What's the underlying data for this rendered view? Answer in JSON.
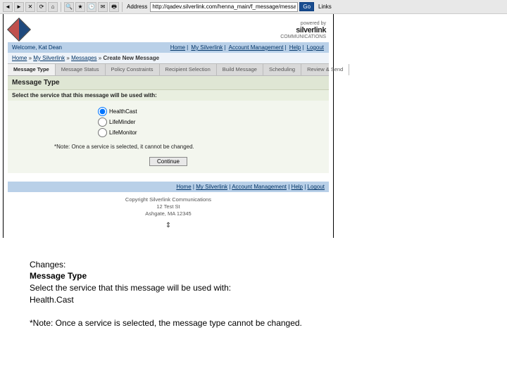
{
  "toolbar": {
    "address_label": "Address",
    "address_value": "http://qadev.silverlink.com/henna_main/f_message/message_list_task?.aspx",
    "go_label": "Go",
    "links_label": "Links"
  },
  "brand": {
    "powered_by": "powered by",
    "company": "silverlink",
    "tagline": "COMMUNICATIONS"
  },
  "welcomebar": {
    "left": "Welcome, Kat Dean",
    "links": [
      "Home",
      "My Silverlink",
      "Account Management",
      "Help",
      "Logout"
    ]
  },
  "breadcrumb": {
    "parts": [
      "Home",
      "My Silverlink",
      "Messages"
    ],
    "current": "Create New Message"
  },
  "tabs": [
    {
      "label": "Message Type",
      "active": true
    },
    {
      "label": "Message Status",
      "active": false
    },
    {
      "label": "Policy Constraints",
      "active": false
    },
    {
      "label": "Recipient Selection",
      "active": false
    },
    {
      "label": "Build Message",
      "active": false
    },
    {
      "label": "Scheduling",
      "active": false
    },
    {
      "label": "Review & Send",
      "active": false
    }
  ],
  "section": {
    "title": "Message Type",
    "subtitle": "Select the service that this message will be used with:",
    "options": [
      {
        "label": "HealthCast",
        "checked": true
      },
      {
        "label": "LifeMinder",
        "checked": false
      },
      {
        "label": "LifeMonitor",
        "checked": false
      }
    ],
    "note": "*Note: Once a service is selected, it cannot be changed.",
    "continue_label": "Continue"
  },
  "footerlinks": [
    "Home",
    "My Silverlink",
    "Account Management",
    "Help",
    "Logout"
  ],
  "copyright": {
    "line1": "Copyright Silverlink Communications",
    "line2": "12 Test St",
    "line3": "Ashgate, MA 12345"
  },
  "notes": {
    "heading": "Changes:",
    "line1": "Message Type",
    "line2": "Select the service that this message will be used with:",
    "line3": "Health.Cast",
    "note": "*Note: Once a service is selected, the message type cannot be changed."
  }
}
